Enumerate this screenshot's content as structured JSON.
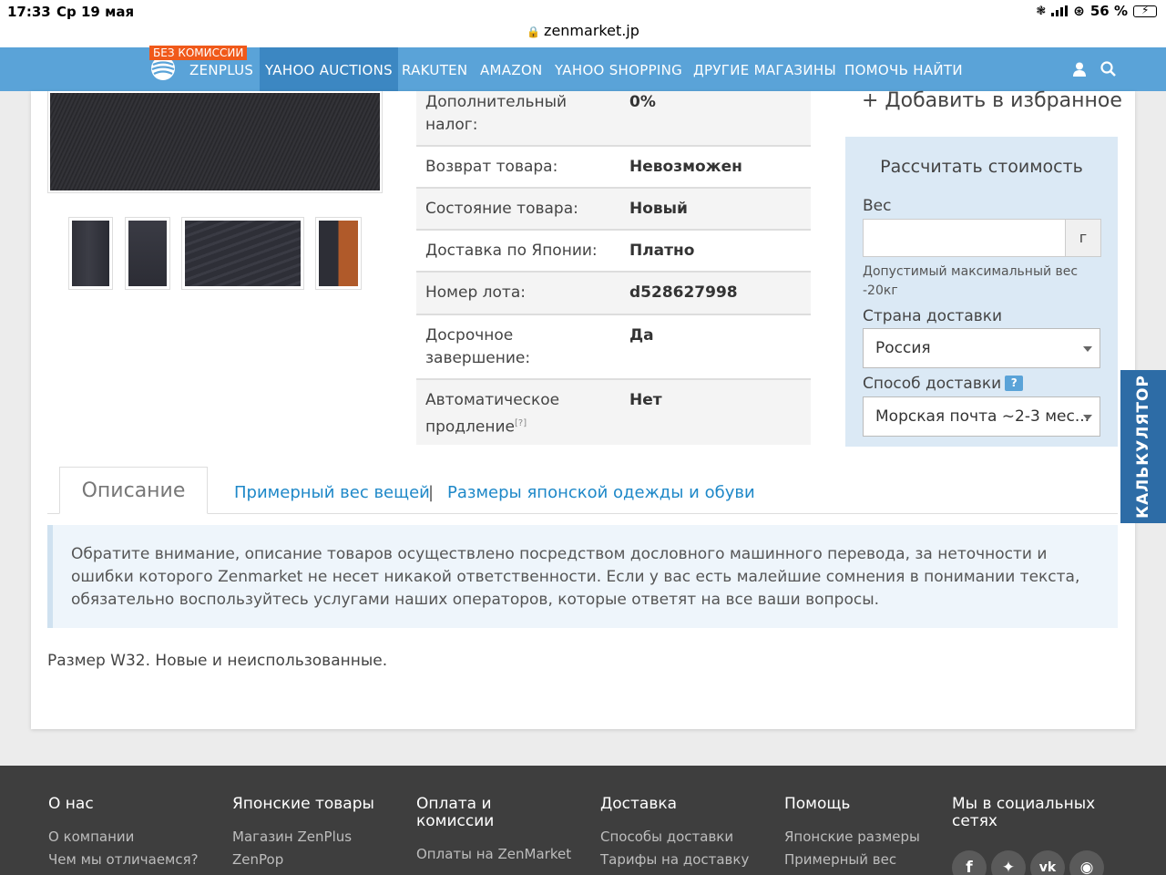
{
  "status_bar": {
    "time": "17:33",
    "date": "Ср 19 мая",
    "url": "zenmarket.jp",
    "battery": "56 %"
  },
  "nav": {
    "badge": "БЕЗ КОМИССИИ",
    "items": [
      "ZENPLUS",
      "YAHOO AUCTIONS",
      "RAKUTEN",
      "AMAZON",
      "YAHOO SHOPPING",
      "ДРУГИЕ МАГАЗИНЫ",
      "ПОМОЧЬ НАЙТИ"
    ],
    "active": "YAHOO AUCTIONS",
    "accent": "#5aa3d8",
    "active_color": "#3c87c2",
    "badge_color": "#f0591a"
  },
  "details": [
    {
      "label_lines": [
        "Дополнительный",
        "налог:"
      ],
      "value": "0%"
    },
    {
      "label_lines": [
        "Возврат товара:"
      ],
      "value": "Невозможен"
    },
    {
      "label_lines": [
        "Состояние товара:"
      ],
      "value": "Новый"
    },
    {
      "label_lines": [
        "Доставка по Японии:"
      ],
      "value": "Платно"
    },
    {
      "label_lines": [
        "Номер лота:"
      ],
      "value": "d528627998"
    },
    {
      "label_lines": [
        "Досрочное",
        "завершение:"
      ],
      "value": "Да"
    },
    {
      "label_lines": [
        "Автоматическое",
        "продление"
      ],
      "label_sup": "[?]",
      "value": "Нет"
    }
  ],
  "favorite": "+ Добавить в избранное",
  "calculator": {
    "title": "Рассчитать стоимость",
    "weight_label": "Вес",
    "weight_value": "",
    "weight_unit": "г",
    "weight_note": "Допустимый максимальный вес -20кг",
    "country_label": "Страна доставки",
    "country_value": "Россия",
    "method_label": "Способ доставки",
    "method_help": "?",
    "method_value": "Морская почта ~2-3 мес..."
  },
  "side_tab": "КАЛЬКУЛЯТОР",
  "tabs": {
    "active": "Описание",
    "links": [
      "Примерный вес вещей",
      "Размеры японской одежды и обуви"
    ],
    "separator": "|"
  },
  "notice": "Обратите внимание, описание товаров осуществлено посредством дословного машинного перевода, за неточности и ошибки которого Zenmarket не несет никакой ответственности. Если у вас есть малейшие сомнения в понимании текста, обязательно воспользуйтесь услугами наших операторов, которые ответят на все ваши вопросы.",
  "description": "Размер W32. Новые и неиспользованные.",
  "footer": {
    "columns": [
      {
        "title": "О нас",
        "links": [
          "О компании",
          "Чем мы отличаемся?"
        ]
      },
      {
        "title": "Японские товары",
        "links": [
          "Магазин ZenPlus",
          "ZenPop"
        ]
      },
      {
        "title": "Оплата и комиссии",
        "links": [
          "Оплаты на ZenMarket"
        ]
      },
      {
        "title": "Доставка",
        "links": [
          "Способы доставки",
          "Тарифы на доставку"
        ]
      },
      {
        "title": "Помощь",
        "links": [
          "Японские размеры",
          "Примерный вес"
        ]
      },
      {
        "title": "Мы в социальных сетях",
        "links": []
      }
    ],
    "social": [
      "facebook",
      "twitter",
      "vk",
      "instagram"
    ]
  }
}
